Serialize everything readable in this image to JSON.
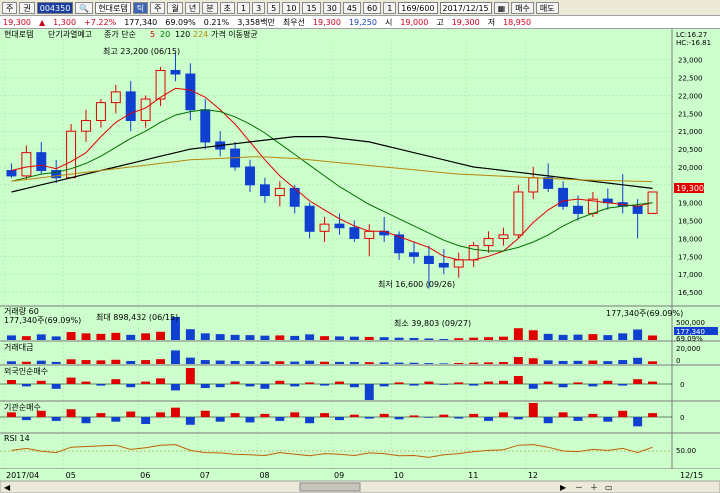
{
  "toolbar": {
    "mode_label": "주",
    "view_label": "권",
    "stock_code": "004350",
    "stock_name": "현대로템",
    "period_buttons": [
      "틱",
      "주",
      "월",
      "년",
      "분",
      "초"
    ],
    "number_buttons": [
      "1",
      "3",
      "5",
      "10",
      "15",
      "30",
      "45",
      "60",
      "1"
    ],
    "count_display": "169/600",
    "date_display": "2017/12/15",
    "buy_label": "매수",
    "sell_label": "매도"
  },
  "quote_bar": {
    "price": "19,300",
    "change_arrow": "▲",
    "change": "1,300",
    "change_pct": "+7.22%",
    "volume": "177,340",
    "volume_ratio": "69.09%",
    "turnover": "0.21%",
    "amount": "3,358백만",
    "preferred_label": "최우선",
    "preferred_bid": "19,300",
    "preferred_ask": "19,250",
    "open_label": "시",
    "open": "19,000",
    "high_label": "고",
    "high": "19,300",
    "low_label": "저",
    "low": "18,950"
  },
  "legend": {
    "name": "현대로템",
    "period_label": "단기과열예고",
    "ma_label": "종가 단순",
    "ma_periods": [
      "5",
      "20",
      "120",
      "224"
    ],
    "ma_suffix": "가격 이동평균"
  },
  "price_panel": {
    "lc_label": "LC:16.27",
    "hc_label": "HC:-16.81",
    "high_annotation": "최고 23,200 (06/15)",
    "low_annotation": "최저 16,600 (09/26)",
    "current_price_tag": "19,300",
    "y_ticks": [
      "23,000",
      "22,500",
      "22,000",
      "21,500",
      "21,000",
      "20,500",
      "20,000",
      "19,500",
      "19,000",
      "18,500",
      "18,000",
      "17,500",
      "17,000",
      "16,500"
    ]
  },
  "volume_panel": {
    "title": "거래량 60",
    "value": "177,340주(69.09%)",
    "max_annotation": "최대 898,432 (06/15)",
    "min_annotation": "최소 39,803 (09/27)",
    "right_value": "177,340주(69.09%)",
    "y_ticks": [
      "500,000",
      "177,340",
      "69.09%"
    ]
  },
  "amount_panel": {
    "title": "거래대금",
    "y_ticks": [
      "20,000",
      "0"
    ]
  },
  "foreign_panel": {
    "title": "외국인순매수",
    "y_ticks": [
      "0"
    ]
  },
  "inst_panel": {
    "title": "기관순매수",
    "y_ticks": [
      "0"
    ]
  },
  "rsi_panel": {
    "title": "RSI 14",
    "y_ticks": [
      "50.00"
    ]
  },
  "x_axis": {
    "labels": [
      "2017/04",
      "05",
      "06",
      "07",
      "08",
      "09",
      "10",
      "11",
      "12"
    ],
    "end_label": "12/15"
  },
  "colors": {
    "chart_bg": "#ccffcc",
    "up": "#e00000",
    "down": "#1040d0",
    "ma5": "#e00000",
    "ma20": "#007000",
    "ma120": "#000000",
    "ma224": "#b8860b"
  },
  "chart_data": {
    "type": "candlestick",
    "title": "현대로템",
    "ylim": [
      16250,
      23300
    ],
    "x_labels": [
      "2017/04",
      "05",
      "06",
      "07",
      "08",
      "09",
      "10",
      "11",
      "12"
    ],
    "ohlc_weekly": [
      [
        19900,
        20100,
        19700,
        19750
      ],
      [
        19750,
        20600,
        19650,
        20400
      ],
      [
        20400,
        20700,
        19800,
        19900
      ],
      [
        19900,
        20200,
        19550,
        19700
      ],
      [
        19700,
        21200,
        19700,
        21000
      ],
      [
        21000,
        21600,
        20700,
        21300
      ],
      [
        21300,
        21900,
        21100,
        21800
      ],
      [
        21800,
        22300,
        21500,
        22100
      ],
      [
        22100,
        22400,
        21000,
        21300
      ],
      [
        21300,
        22000,
        21100,
        21900
      ],
      [
        21900,
        22800,
        21700,
        22700
      ],
      [
        22700,
        23200,
        22400,
        22600
      ],
      [
        22600,
        22900,
        21300,
        21600
      ],
      [
        21600,
        21900,
        20500,
        20700
      ],
      [
        20700,
        21000,
        20300,
        20500
      ],
      [
        20500,
        20700,
        19900,
        20000
      ],
      [
        20000,
        20200,
        19300,
        19500
      ],
      [
        19500,
        19700,
        19000,
        19200
      ],
      [
        19200,
        19600,
        18900,
        19400
      ],
      [
        19400,
        19500,
        18700,
        18900
      ],
      [
        18900,
        19000,
        18000,
        18200
      ],
      [
        18200,
        18600,
        17900,
        18400
      ],
      [
        18400,
        18700,
        18100,
        18300
      ],
      [
        18300,
        18500,
        17900,
        18000
      ],
      [
        18000,
        18400,
        17500,
        18200
      ],
      [
        18200,
        18600,
        17900,
        18100
      ],
      [
        18100,
        18200,
        17400,
        17600
      ],
      [
        17600,
        17900,
        17300,
        17500
      ],
      [
        17500,
        17800,
        16600,
        17300
      ],
      [
        17300,
        17700,
        17000,
        17200
      ],
      [
        17200,
        17600,
        16900,
        17400
      ],
      [
        17400,
        17900,
        17200,
        17800
      ],
      [
        17800,
        18200,
        17600,
        18000
      ],
      [
        18000,
        18300,
        17800,
        18100
      ],
      [
        18100,
        19500,
        18000,
        19300
      ],
      [
        19300,
        20000,
        19100,
        19700
      ],
      [
        19700,
        20100,
        19300,
        19400
      ],
      [
        19400,
        19600,
        18800,
        18900
      ],
      [
        18900,
        19200,
        18500,
        18700
      ],
      [
        18700,
        19300,
        18600,
        19100
      ],
      [
        19100,
        19400,
        18800,
        19000
      ],
      [
        19000,
        19800,
        18700,
        18900
      ],
      [
        18900,
        19100,
        18000,
        18700
      ],
      [
        18700,
        19300,
        18950,
        19300
      ]
    ],
    "series": [
      {
        "name": "5",
        "values": [
          19900,
          20000,
          20050,
          19950,
          20150,
          20400,
          20850,
          21250,
          21500,
          21650,
          21950,
          22200,
          22150,
          21950,
          21600,
          21200,
          20700,
          20200,
          19750,
          19400,
          19050,
          18800,
          18550,
          18350,
          18200,
          18200,
          18050,
          17900,
          17750,
          17500,
          17400,
          17400,
          17500,
          17650,
          18000,
          18450,
          18800,
          19050,
          19100,
          19050,
          19000,
          18950,
          18900,
          19000
        ]
      },
      {
        "name": "20",
        "values": [
          19600,
          19700,
          19800,
          19850,
          19950,
          20100,
          20300,
          20550,
          20800,
          21000,
          21250,
          21450,
          21550,
          21600,
          21550,
          21400,
          21200,
          20950,
          20650,
          20350,
          20050,
          19750,
          19450,
          19200,
          18950,
          18750,
          18550,
          18350,
          18150,
          17950,
          17800,
          17700,
          17650,
          17650,
          17750,
          17900,
          18100,
          18350,
          18550,
          18700,
          18850,
          18900,
          18950,
          19000
        ]
      },
      {
        "name": "120",
        "values": [
          19300,
          19400,
          19500,
          19600,
          19700,
          19800,
          19900,
          20000,
          20100,
          20200,
          20300,
          20400,
          20500,
          20550,
          20600,
          20650,
          20700,
          20750,
          20800,
          20850,
          20850,
          20850,
          20800,
          20750,
          20700,
          20600,
          20500,
          20400,
          20300,
          20200,
          20100,
          20000,
          19950,
          19900,
          19850,
          19800,
          19750,
          19700,
          19650,
          19600,
          19550,
          19500,
          19450,
          19400
        ]
      },
      {
        "name": "224",
        "values": [
          19600,
          19650,
          19700,
          19750,
          19800,
          19850,
          19900,
          19950,
          20000,
          20050,
          20100,
          20150,
          20200,
          20220,
          20240,
          20260,
          20280,
          20280,
          20260,
          20240,
          20200,
          20160,
          20120,
          20080,
          20040,
          20000,
          19960,
          19920,
          19880,
          19840,
          19800,
          19780,
          19760,
          19740,
          19720,
          19700,
          19680,
          19660,
          19640,
          19630,
          19620,
          19610,
          19600,
          19590
        ]
      }
    ],
    "volume": [
      180,
      150,
      220,
      140,
      310,
      260,
      240,
      280,
      200,
      260,
      320,
      898,
      420,
      260,
      230,
      200,
      190,
      170,
      180,
      160,
      220,
      150,
      140,
      130,
      120,
      110,
      90,
      80,
      60,
      40,
      70,
      90,
      110,
      130,
      460,
      380,
      240,
      200,
      210,
      230,
      190,
      260,
      410,
      177
    ],
    "foreign": [
      5,
      -3,
      4,
      -6,
      8,
      3,
      -2,
      6,
      -4,
      3,
      7,
      -8,
      20,
      -5,
      -4,
      3,
      -3,
      -6,
      4,
      -3,
      2,
      -2,
      3,
      -4,
      -20,
      -3,
      2,
      -2,
      3,
      -1,
      2,
      -2,
      3,
      4,
      10,
      -6,
      3,
      -4,
      2,
      -3,
      4,
      -2,
      6,
      3
    ],
    "inst": [
      6,
      -4,
      8,
      -5,
      10,
      -8,
      5,
      -6,
      7,
      -9,
      6,
      12,
      -10,
      8,
      -6,
      5,
      -7,
      4,
      -5,
      6,
      -8,
      5,
      -4,
      3,
      -2,
      4,
      -3,
      2,
      -1,
      3,
      -2,
      4,
      -5,
      6,
      -3,
      18,
      -8,
      6,
      -5,
      4,
      -6,
      8,
      -12,
      5
    ],
    "rsi": [
      52,
      58,
      49,
      45,
      62,
      64,
      66,
      68,
      55,
      60,
      68,
      70,
      52,
      45,
      44,
      40,
      38,
      36,
      45,
      40,
      35,
      42,
      40,
      36,
      44,
      42,
      35,
      36,
      30,
      38,
      42,
      48,
      52,
      54,
      68,
      70,
      62,
      50,
      48,
      55,
      52,
      58,
      45,
      62
    ]
  }
}
